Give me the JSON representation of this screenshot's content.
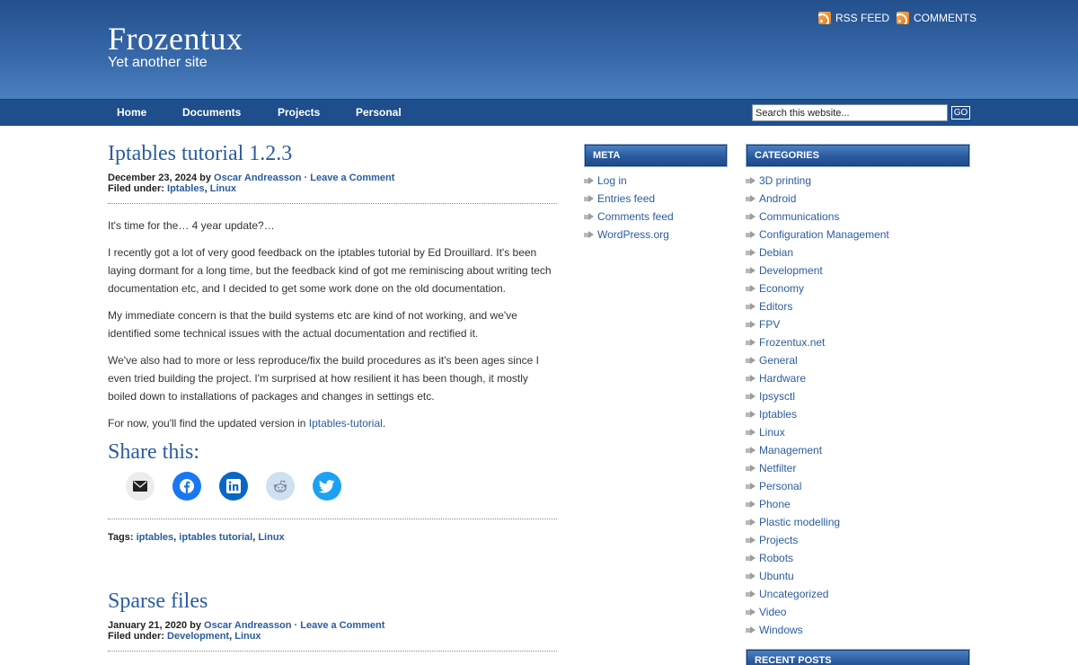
{
  "site": {
    "title": "Frozentux",
    "tagline": "Yet another site"
  },
  "feeds": {
    "rss": "RSS FEED",
    "comments": "COMMENTS"
  },
  "nav": [
    "Home",
    "Documents",
    "Projects",
    "Personal"
  ],
  "search": {
    "value": "Search this website...",
    "button": "GO"
  },
  "posts": [
    {
      "title": "Iptables tutorial 1.2.3",
      "date": "December 23, 2024",
      "by": "by",
      "author": "Oscar Andreasson",
      "sep": "·",
      "comment_link": "Leave a Comment",
      "filed_label": "Filed under:",
      "categories": [
        "Iptables",
        "Linux"
      ],
      "paragraphs": [
        "It's time for the… 4 year update?…",
        "I recently got a lot of very good feedback on the iptables tutorial by Ed Drouillard. It's been laying dormant for a long time, but the feedback kind of got me reminiscing about writing tech documentation etc, and I decided to get some work done on the old documentation.",
        "My immediate concern is that the build systems etc are kind of not working, and we've identified some technical issues with the actual documentation and rectified it.",
        "We've also had to more or less reproduce/fix the build procedures as it's been ages since I even tried building the project. I'm surprised at how resilient it has been though, it mostly boiled down to installations of packages and changes in settings etc."
      ],
      "last_para_prefix": "For now, you'll find the updated version in ",
      "last_para_link": "Iptables-tutorial",
      "last_para_suffix": ".",
      "share_title": "Share this:",
      "tags_label": "Tags:",
      "tags": [
        "iptables",
        "iptables tutorial",
        "Linux"
      ]
    },
    {
      "title": "Sparse files",
      "date": "January 21, 2020",
      "by": "by",
      "author": "Oscar Andreasson",
      "sep": "·",
      "comment_link": "Leave a Comment",
      "filed_label": "Filed under:",
      "categories": [
        "Development",
        "Linux"
      ]
    }
  ],
  "share_icons": [
    "email-icon",
    "facebook-icon",
    "linkedin-icon",
    "reddit-icon",
    "twitter-icon"
  ],
  "meta": {
    "title": "META",
    "items": [
      "Log in",
      "Entries feed",
      "Comments feed",
      "WordPress.org"
    ]
  },
  "categories": {
    "title": "CATEGORIES",
    "items": [
      "3D printing",
      "Android",
      "Communications",
      "Configuration Management",
      "Debian",
      "Development",
      "Economy",
      "Editors",
      "FPV",
      "Frozentux.net",
      "General",
      "Hardware",
      "Ipsysctl",
      "Iptables",
      "Linux",
      "Management",
      "Netfilter",
      "Personal",
      "Phone",
      "Plastic modelling",
      "Projects",
      "Robots",
      "Ubuntu",
      "Uncategorized",
      "Video",
      "Windows"
    ]
  },
  "recent": {
    "title": "RECENT POSTS"
  },
  "colors": {
    "header_top": "#23508d",
    "nav_bg": "#1e4e8c",
    "link": "#2b5c9e",
    "rss": "#e8720c",
    "facebook": "#1877f2",
    "linkedin": "#0a66c2",
    "twitter": "#1da1f2"
  }
}
